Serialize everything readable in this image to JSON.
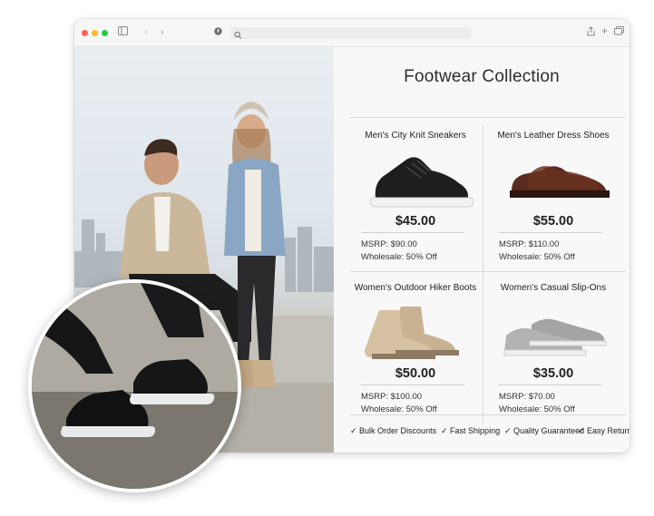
{
  "browser": {
    "traffic_lights": [
      "#ff5f57",
      "#febc2e",
      "#28c840"
    ],
    "icons": [
      "sidebar-icon",
      "back-icon",
      "forward-icon",
      "privacy-icon",
      "search-icon",
      "share-icon",
      "new-tab-icon",
      "tabs-icon"
    ]
  },
  "catalog": {
    "title": "Footwear Collection",
    "products": [
      {
        "name": "Men's City Knit Sneakers",
        "price": "$45.00",
        "msrp": "MSRP: $90.00",
        "wholesale": "Wholesale: 50% Off"
      },
      {
        "name": "Men's Leather Dress Shoes",
        "price": "$55.00",
        "msrp": "MSRP: $110.00",
        "wholesale": "Wholesale: 50% Off"
      },
      {
        "name": "Women's Outdoor Hiker Boots",
        "price": "$50.00",
        "msrp": "MSRP: $100.00",
        "wholesale": "Wholesale: 50% Off"
      },
      {
        "name": "Women's Casual Slip-Ons",
        "price": "$35.00",
        "msrp": "MSRP: $70.00",
        "wholesale": "Wholesale: 50% Off"
      }
    ],
    "features": [
      "✓ Bulk Order Discounts",
      "✓ Fast Shipping",
      "✓ Quality Guaranteed",
      "✓ Easy Return"
    ]
  }
}
